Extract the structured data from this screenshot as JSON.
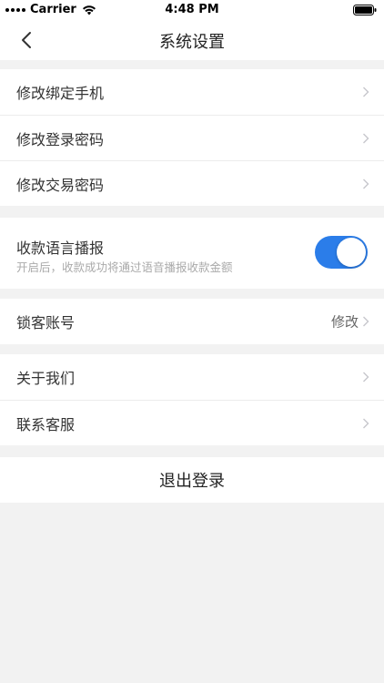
{
  "status_bar": {
    "carrier": "Carrier",
    "time": "4:48 PM"
  },
  "nav": {
    "title": "系统设置"
  },
  "account_group": {
    "items": [
      {
        "label": "修改绑定手机"
      },
      {
        "label": "修改登录密码"
      },
      {
        "label": "修改交易密码"
      }
    ]
  },
  "voice": {
    "title": "收款语言播报",
    "description": "开启后，收款成功将通过语音播报收款金额",
    "enabled": true,
    "accent_color": "#2b7de9"
  },
  "lock_account": {
    "label": "锁客账号",
    "value": "修改"
  },
  "about_group": {
    "items": [
      {
        "label": "关于我们"
      },
      {
        "label": "联系客服"
      }
    ]
  },
  "logout": {
    "label": "退出登录"
  },
  "icons": [
    "back-arrow-icon",
    "chevron-right-icon",
    "wifi-icon",
    "battery-icon"
  ]
}
